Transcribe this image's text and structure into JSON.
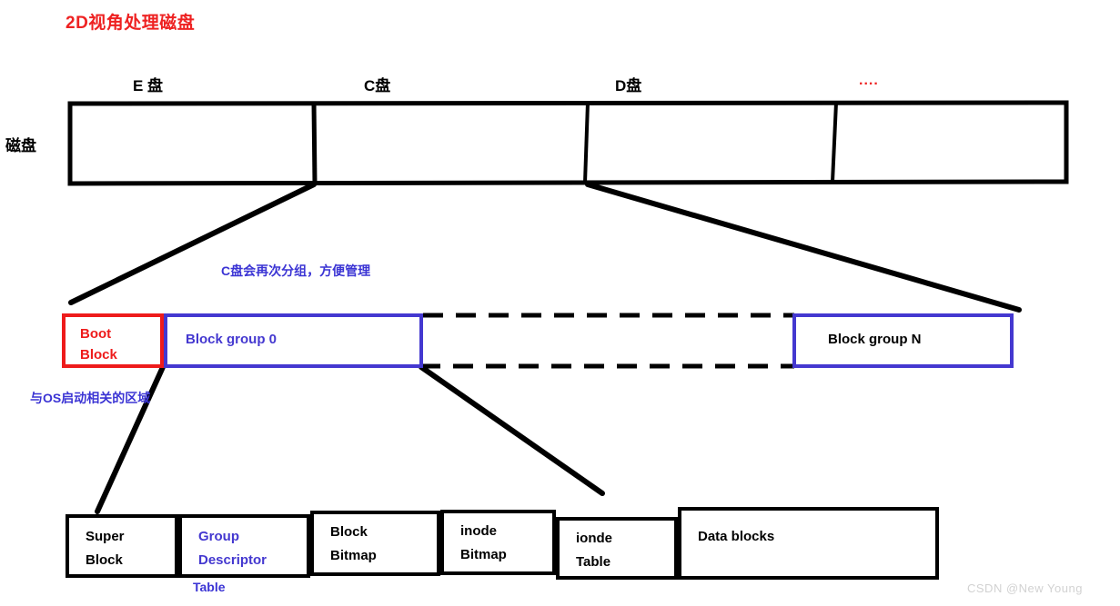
{
  "title": "2D视角处理磁盘",
  "disk_row": {
    "row_label": "磁盘",
    "partitions": [
      {
        "label": "E 盘"
      },
      {
        "label": "C盘"
      },
      {
        "label": "D盘"
      }
    ],
    "ellipsis": "...."
  },
  "notes": {
    "c_partition": "C盘会再次分组，方便管理",
    "boot_block": "与OS启动相关的区域",
    "gdt_table": "Table"
  },
  "block_group_row": {
    "boot_block": "Boot\nBlock",
    "group_0": "Block group 0",
    "group_n": "Block group N"
  },
  "detail_row": {
    "boxes": [
      {
        "label": "Super\nBlock",
        "color": "#000000"
      },
      {
        "label": "Group\nDescriptor",
        "color": "#4438d0"
      },
      {
        "label": "Block\nBitmap",
        "color": "#000000"
      },
      {
        "label": "inode\nBitmap",
        "color": "#000000"
      },
      {
        "label": "ionde\nTable",
        "color": "#000000"
      },
      {
        "label": "Data blocks",
        "color": "#000000"
      }
    ]
  },
  "watermark": "CSDN @New  Young",
  "colors": {
    "title_red": "#ee2222",
    "boot_red": "#ee1b1b",
    "accent_blue": "#4438d0",
    "note_blue": "#3b34d4",
    "stroke_black": "#000000",
    "watermark_gray": "#d2d2d2"
  }
}
